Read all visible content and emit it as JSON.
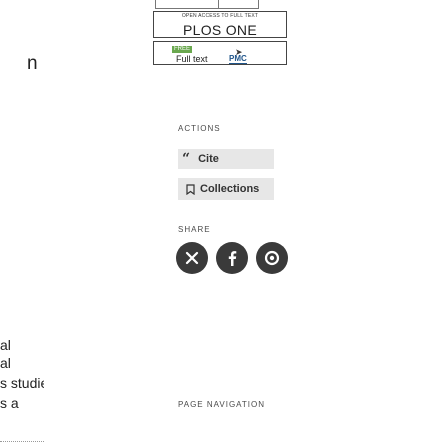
{
  "left_fragments": [
    "n",
    "al",
    "al",
    "s studies",
    "s a"
  ],
  "journal_box": {
    "open_access": "OPEN ACCESS TO FULL TEXT",
    "name": "PLOS ONE"
  },
  "pmc_box": {
    "free_badge": "FREE",
    "full_text": "Full text",
    "logo_text": "PMC"
  },
  "actions": {
    "heading": "ACTIONS",
    "cite_label": "Cite",
    "collections_label": "Collections"
  },
  "share": {
    "heading": "SHARE",
    "buttons": [
      "x-icon",
      "facebook-icon",
      "email-icon"
    ]
  },
  "page_navigation": {
    "heading": "PAGE NAVIGATION"
  },
  "colors": {
    "button_bg": "#e7e7e7",
    "share_bg": "#3a3a3a",
    "free_badge": "#6aa84f",
    "pmc_blue": "#20558a"
  }
}
